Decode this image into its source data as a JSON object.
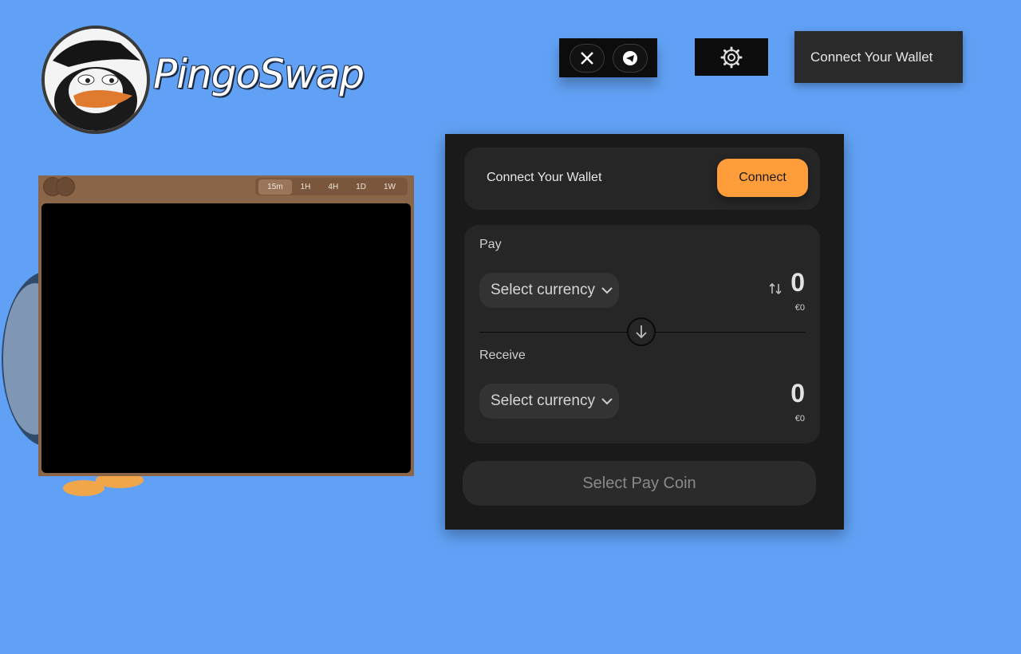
{
  "brand": {
    "name": "PingoSwap"
  },
  "header": {
    "social": [
      {
        "icon": "x-icon"
      },
      {
        "icon": "telegram-icon"
      }
    ],
    "settings_icon": "gear-icon",
    "wallet_button_label": "Connect Your Wallet"
  },
  "chart_widget": {
    "timeframes": [
      "15m",
      "1H",
      "4H",
      "1D",
      "1W"
    ],
    "active_timeframe": "15m"
  },
  "swap": {
    "connect_prompt": "Connect Your Wallet",
    "connect_button_label": "Connect",
    "pay": {
      "label": "Pay",
      "select_placeholder": "Select currency",
      "amount": "0",
      "fiat": "€0"
    },
    "receive": {
      "label": "Receive",
      "select_placeholder": "Select currency",
      "amount": "0",
      "fiat": "€0"
    },
    "action_button_label": "Select Pay Coin"
  },
  "colors": {
    "background": "#61a1f5",
    "accent": "#ff9d3b",
    "panel": "#1a1a1a",
    "card": "#262626"
  }
}
